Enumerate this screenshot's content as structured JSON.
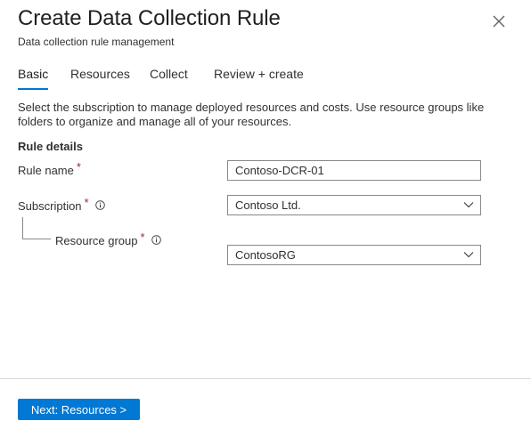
{
  "header": {
    "title": "Create Data Collection Rule",
    "subtitle": "Data collection rule management"
  },
  "tabs": [
    {
      "label": "Basic",
      "active": true
    },
    {
      "label": "Resources",
      "active": false
    },
    {
      "label": "Collect",
      "active": false
    },
    {
      "label": "Review + create",
      "active": false
    }
  ],
  "description": "Select the subscription to manage deployed resources and costs. Use resource groups like folders to organize and manage all of your resources.",
  "section_title": "Rule details",
  "form": {
    "rule_name": {
      "label": "Rule name",
      "required_mark": "*",
      "value": "Contoso-DCR-01"
    },
    "subscription": {
      "label": "Subscription",
      "required_mark": "*",
      "value": "Contoso Ltd."
    },
    "resource_group": {
      "label": "Resource group",
      "required_mark": "*",
      "value": "ContosoRG"
    }
  },
  "footer": {
    "next_label": "Next: Resources >"
  },
  "colors": {
    "accent": "#0078d4",
    "required": "#a4262c",
    "border": "#8a8886"
  },
  "icons": [
    "close-icon",
    "info-icon",
    "chevron-down-icon"
  ]
}
